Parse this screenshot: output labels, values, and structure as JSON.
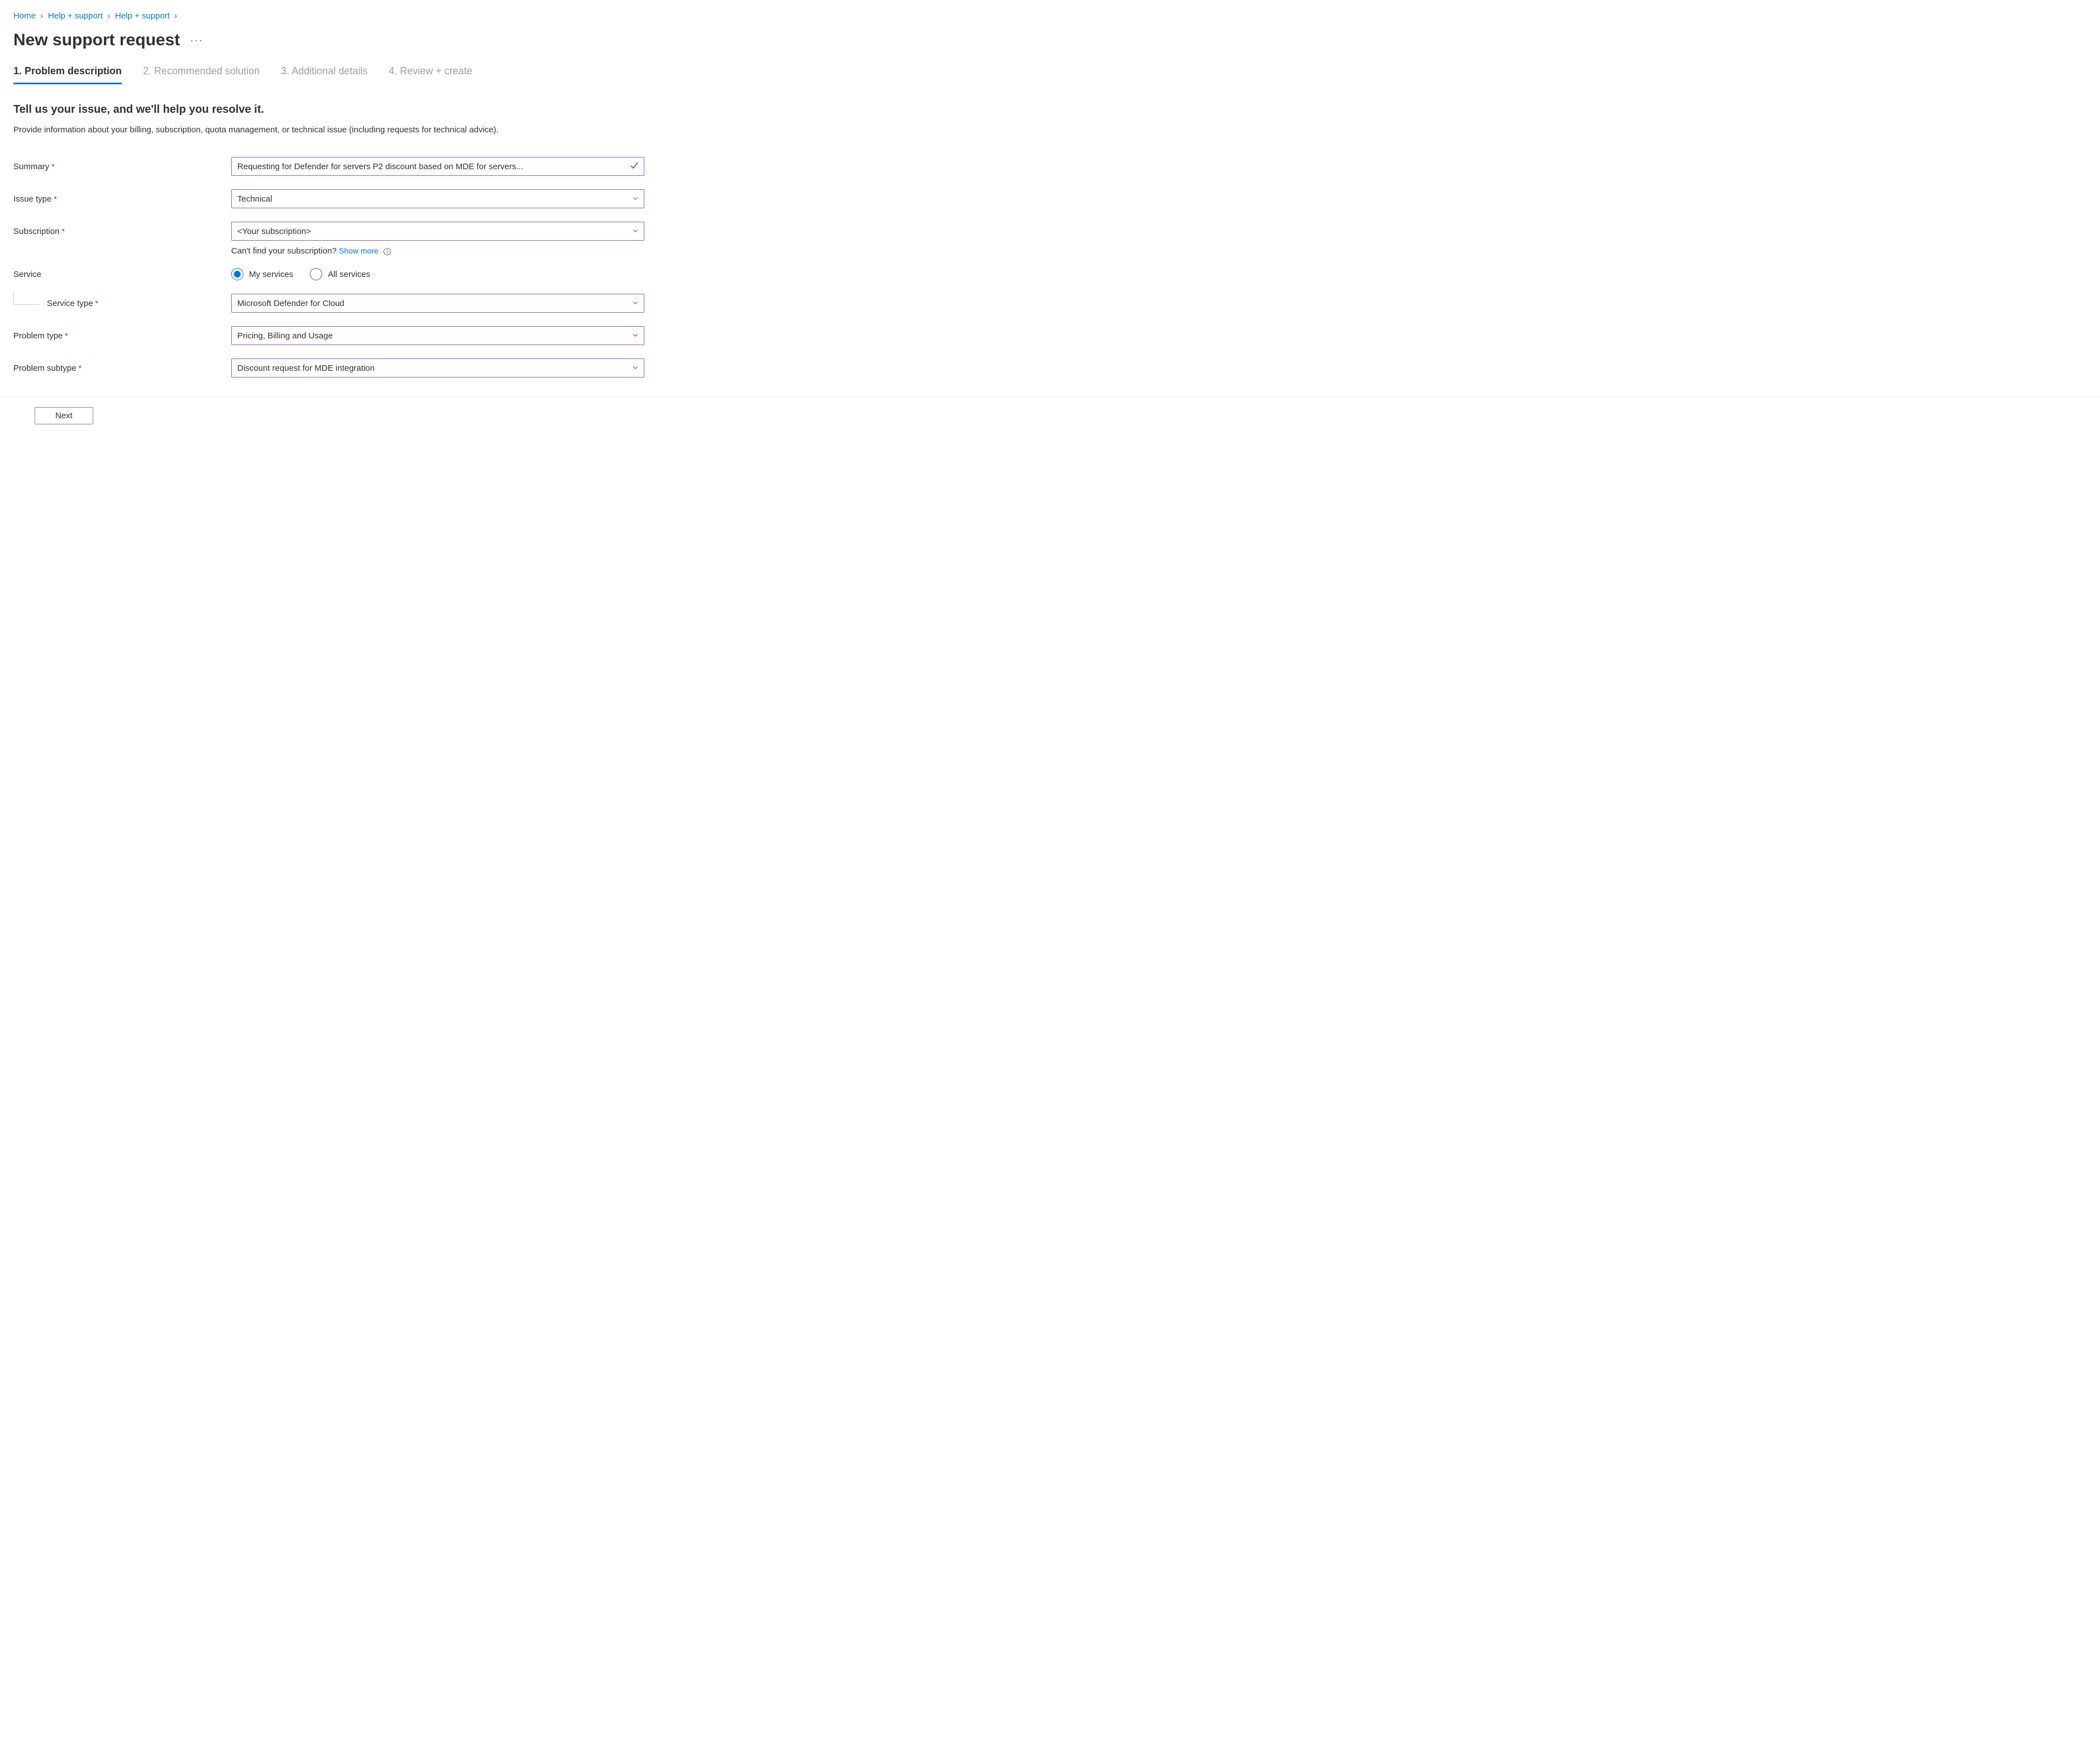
{
  "breadcrumb": {
    "items": [
      {
        "label": "Home"
      },
      {
        "label": "Help + support"
      },
      {
        "label": "Help + support"
      }
    ]
  },
  "page": {
    "title": "New support request"
  },
  "tabs": [
    {
      "label": "1. Problem description",
      "active": true
    },
    {
      "label": "2. Recommended solution",
      "active": false
    },
    {
      "label": "3. Additional details",
      "active": false
    },
    {
      "label": "4. Review + create",
      "active": false
    }
  ],
  "section": {
    "title": "Tell us your issue, and we'll help you resolve it.",
    "description": "Provide information about your billing, subscription, quota management, or technical issue (including requests for technical advice)."
  },
  "form": {
    "summary": {
      "label": "Summary",
      "value": "Requesting for Defender for servers P2 discount based on MDE for servers..."
    },
    "issue_type": {
      "label": "Issue type",
      "value": "Technical"
    },
    "subscription": {
      "label": "Subscription",
      "value": "<Your subscription>",
      "hint_prefix": "Can't find your subscription? ",
      "hint_link": "Show more"
    },
    "service": {
      "label": "Service",
      "options": {
        "my": "My services",
        "all": "All services"
      }
    },
    "service_type": {
      "label": "Service type",
      "value": "Microsoft Defender for Cloud"
    },
    "problem_type": {
      "label": "Problem type",
      "value": "Pricing, Billing and Usage"
    },
    "problem_subtype": {
      "label": "Problem subtype",
      "value": "Discount request for MDE integration"
    }
  },
  "footer": {
    "next_label": "Next"
  }
}
